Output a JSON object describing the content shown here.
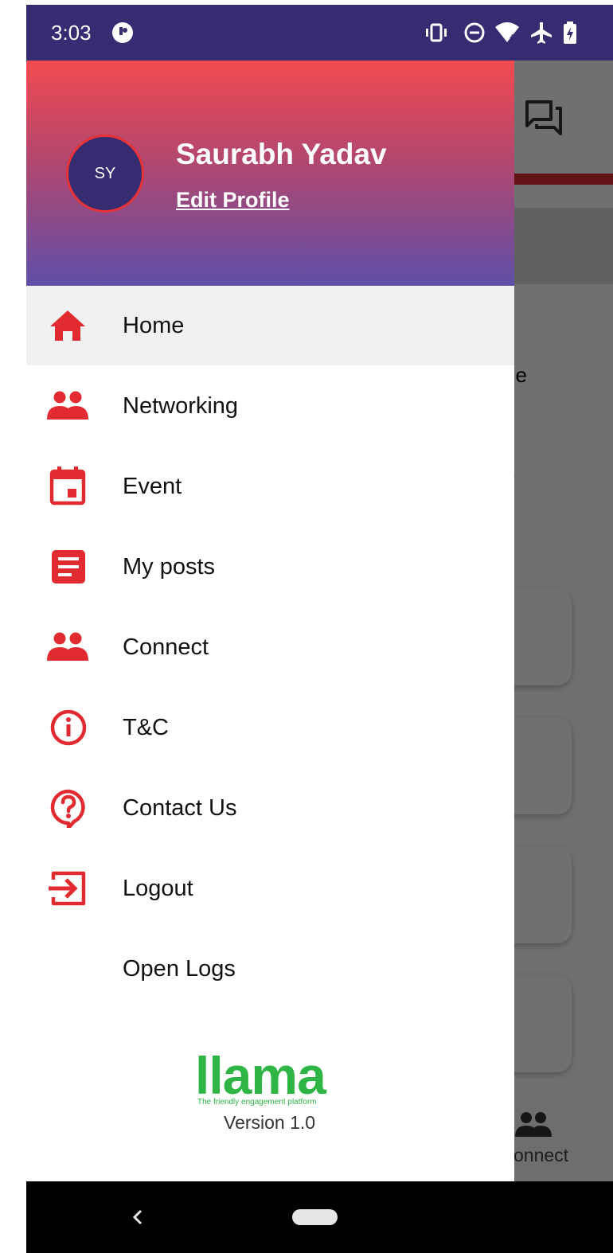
{
  "status_bar": {
    "time": "3:03",
    "icons": [
      "app-notification-icon",
      "vibrate-icon",
      "do-not-disturb-icon",
      "wifi-icon",
      "airplane-mode-icon",
      "battery-charging-icon"
    ]
  },
  "background_app": {
    "text_lines": [
      "ne",
      "e"
    ],
    "bottom_nav_label": "onnect"
  },
  "drawer": {
    "header": {
      "avatar_initials": "SY",
      "user_name": "Saurabh Yadav",
      "edit_profile_label": "Edit Profile"
    },
    "menu": [
      {
        "label": "Home",
        "icon": "home-icon",
        "active": true
      },
      {
        "label": "Networking",
        "icon": "people-icon",
        "active": false
      },
      {
        "label": "Event",
        "icon": "calendar-icon",
        "active": false
      },
      {
        "label": "My posts",
        "icon": "document-icon",
        "active": false
      },
      {
        "label": "Connect",
        "icon": "people-icon",
        "active": false
      },
      {
        "label": "T&C",
        "icon": "info-icon",
        "active": false
      },
      {
        "label": "Contact Us",
        "icon": "help-icon",
        "active": false
      },
      {
        "label": "Logout",
        "icon": "logout-icon",
        "active": false
      },
      {
        "label": "Open Logs",
        "icon": "",
        "active": false
      }
    ],
    "footer": {
      "logo_text": "llama",
      "tagline": "The friendly engagement platform",
      "version": "Version 1.0"
    }
  },
  "colors": {
    "status_bar": "#352c72",
    "accent_red": "#e22b30",
    "logo_green": "#2fb545",
    "header_gradient_top": "#f24a50",
    "header_gradient_bottom": "#5f4fa8"
  }
}
